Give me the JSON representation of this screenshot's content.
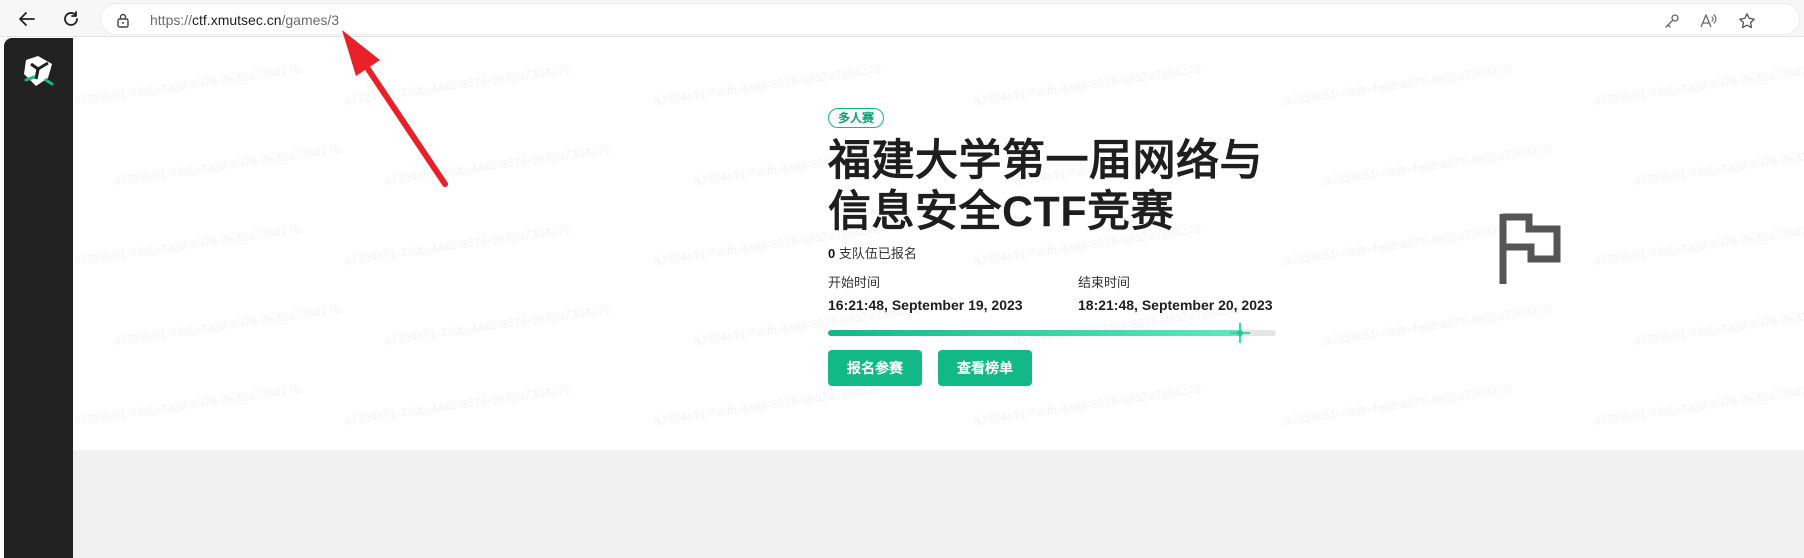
{
  "browser": {
    "url_scheme": "https://",
    "url_host": "ctf.xmutsec.cn",
    "url_path": "/games/3"
  },
  "sidebar": {
    "logo_icon": "app-logo-icon"
  },
  "game": {
    "badge": "多人赛",
    "title": "福建大学第一届网络与信息安全CTF竞赛",
    "teams_count": "0",
    "teams_suffix": " 支队伍已报名",
    "start_label": "开始时间",
    "start_value": "16:21:48, September 19, 2023",
    "end_label": "结束时间",
    "end_value": "18:21:48, September 20, 2023",
    "progress_fraction": 0.92,
    "join_button": "报名参赛",
    "scoreboard_button": "查看榜单"
  },
  "colors": {
    "accent": "#12b886",
    "sidebar": "#212121",
    "annotation_arrow": "#e8202a"
  }
}
